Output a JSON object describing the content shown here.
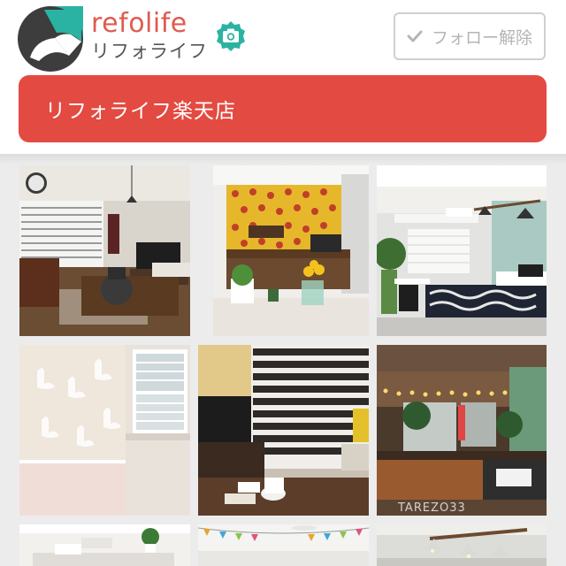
{
  "header": {
    "brand_name": "refolife",
    "brand_name_ja": "リフォライフ",
    "follow_button_label": "フォロー解除"
  },
  "shop_banner": {
    "label": "リフォライフ楽天店"
  },
  "photos": [
    {
      "name": "living-room-photo"
    },
    {
      "name": "yellow-wallpaper-photo"
    },
    {
      "name": "bedroom-photo"
    },
    {
      "name": "swan-wallpaper-photo"
    },
    {
      "name": "blinds-room-photo"
    },
    {
      "name": "string-lights-room-photo"
    },
    {
      "name": "white-interior-photo"
    },
    {
      "name": "bunting-room-photo"
    },
    {
      "name": "lamp-room-photo"
    }
  ],
  "photo_watermark": "TAREZO33",
  "colors": {
    "brand_red": "#e34a41",
    "brand_text_red": "#e05a4e",
    "logo_teal": "#2ab3a3",
    "logo_dark": "#3d3d3d",
    "follow_border": "#cfcfcf",
    "grid_background": "#ececec"
  },
  "icons": {
    "logo": "refolife-logo-icon",
    "camera": "camera-icon",
    "check": "check-icon"
  }
}
